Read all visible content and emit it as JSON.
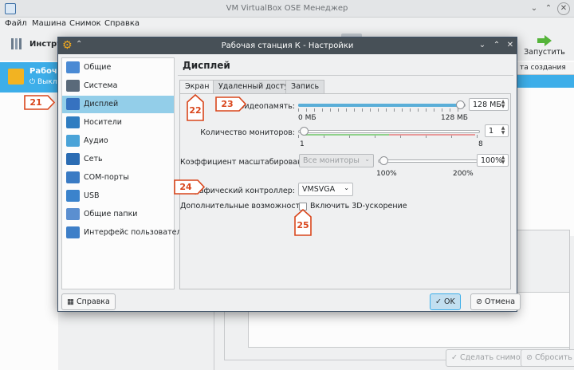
{
  "main_window": {
    "title": "VM VirtualBox OSE Менеджер",
    "menu": [
      "Файл",
      "Машина",
      "Снимок",
      "Справка"
    ],
    "tools_label": "Инстру",
    "launch_label": "Запустить",
    "vm": {
      "name": "Рабочая",
      "state": "Выкл"
    },
    "snapshot_column": "та создания",
    "buttons": {
      "take_snapshot": "Сделать снимок",
      "reset": "Сбросить"
    }
  },
  "dialog": {
    "title": "Рабочая станция К - Настройки",
    "nav": [
      {
        "label": "Общие",
        "icon": "general-icon",
        "color": "#4a8ad4"
      },
      {
        "label": "Система",
        "icon": "system-icon",
        "color": "#5a6a7a"
      },
      {
        "label": "Дисплей",
        "icon": "display-icon",
        "color": "#3672c0"
      },
      {
        "label": "Носители",
        "icon": "storage-icon",
        "color": "#2f7dc1"
      },
      {
        "label": "Аудио",
        "icon": "audio-icon",
        "color": "#4aa3d8"
      },
      {
        "label": "Сеть",
        "icon": "network-icon",
        "color": "#2b6cb3"
      },
      {
        "label": "COM-порты",
        "icon": "serial-port-icon",
        "color": "#3a7bc4"
      },
      {
        "label": "USB",
        "icon": "usb-icon",
        "color": "#3b83cc"
      },
      {
        "label": "Общие папки",
        "icon": "shared-folder-icon",
        "color": "#5b8fd0"
      },
      {
        "label": "Интерфейс пользователя",
        "icon": "user-interface-icon",
        "color": "#3e7fc8"
      }
    ],
    "selected_nav": 2,
    "section_title": "Дисплей",
    "tabs": [
      "Экран",
      "Удаленный доступ",
      "Запись"
    ],
    "active_tab": 0,
    "screen": {
      "video_memory": {
        "label": "Видеопамять:",
        "value": "128 МБ",
        "min_label": "0 МБ",
        "max_label": "128 МБ",
        "level": 1.0
      },
      "monitors": {
        "label": "Количество мониторов:",
        "value": "1",
        "min_label": "1",
        "max_label": "8",
        "level": 0.0
      },
      "scale": {
        "label": "Коэффициент масштабирования:",
        "combo": "Все мониторы",
        "value": "100%",
        "min_label": "100%",
        "max_label": "200%",
        "level": 0.0
      },
      "graphics_controller": {
        "label": "Графический контроллер:",
        "value": "VMSVGA"
      },
      "extended": {
        "label": "Дополнительные возможности:",
        "checkbox_label": "Включить 3D-ускорение",
        "checked": false
      }
    },
    "buttons": {
      "help": "Справка",
      "ok": "OK",
      "cancel": "Отмена"
    }
  },
  "callouts": {
    "c21": "21",
    "c22": "22",
    "c23": "23",
    "c24": "24",
    "c25": "25"
  },
  "accent_color": "#3daee9",
  "callout_color": "#d9461c"
}
